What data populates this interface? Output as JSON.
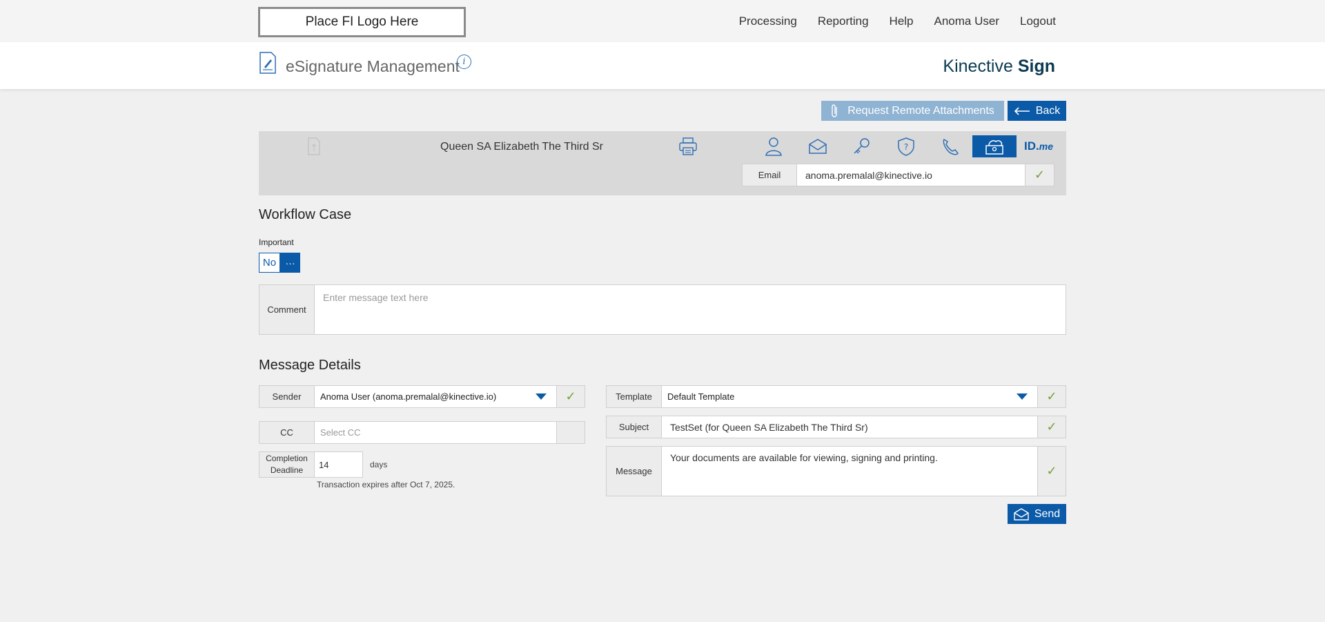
{
  "top_bar": {
    "logo_placeholder": "Place FI Logo Here",
    "nav": [
      {
        "label": "Processing"
      },
      {
        "label": "Reporting"
      },
      {
        "label": "Help"
      },
      {
        "label": "Anoma User"
      },
      {
        "label": "Logout"
      }
    ]
  },
  "header": {
    "title": "eSignature Management",
    "brand_light": "Kinective",
    "brand_bold": "Sign"
  },
  "actions": {
    "request_attachments": "Request Remote Attachments",
    "back": "Back"
  },
  "signer": {
    "name": "Queen SA Elizabeth The Third Sr",
    "auth_methods": [
      {
        "icon": "person-icon",
        "active": false
      },
      {
        "icon": "email-envelope-icon",
        "active": false
      },
      {
        "icon": "key-icon",
        "active": false
      },
      {
        "icon": "security-question-icon",
        "active": false
      },
      {
        "icon": "phone-icon",
        "active": false
      },
      {
        "icon": "cloud-id-icon",
        "active": true
      },
      {
        "icon": "idme-icon",
        "active": false,
        "label_main": "ID.",
        "label_sub": "me"
      }
    ],
    "email_label": "Email",
    "email_value": "anoma.premalal@kinective.io"
  },
  "workflow": {
    "title": "Workflow Case",
    "important_label": "Important",
    "important_value": "No",
    "more": "···",
    "comment_label": "Comment",
    "comment_placeholder": "Enter message text here"
  },
  "message": {
    "title": "Message Details",
    "sender_label": "Sender",
    "sender_value": "Anoma User (anoma.premalal@kinective.io)",
    "cc_label": "CC",
    "cc_placeholder": "Select CC",
    "deadline_label": "Completion Deadline",
    "deadline_value": "14",
    "deadline_unit": "days",
    "expiry_note": "Transaction expires after Oct 7, 2025.",
    "template_label": "Template",
    "template_value": "Default Template",
    "subject_label": "Subject",
    "subject_value": "TestSet (for Queen SA Elizabeth The Third Sr)",
    "message_label": "Message",
    "message_value": "Your documents are available for viewing, signing and printing.",
    "send": "Send"
  },
  "colors": {
    "primary": "#0b5aa8",
    "primary_disabled": "#8fb3d3",
    "check": "#74a03a"
  }
}
